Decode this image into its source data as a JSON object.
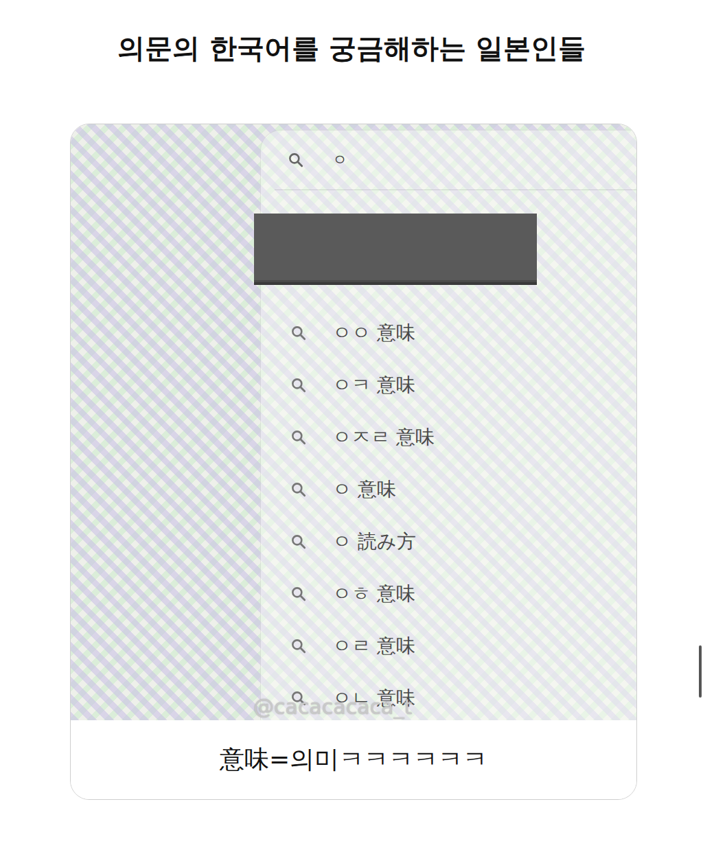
{
  "title": "의문의 한국어를 궁금해하는 일본인들",
  "search": {
    "query": "ㅇ"
  },
  "suggestions": [
    "ㅇㅇ 意味",
    "ㅇㅋ 意味",
    "ㅇㅈㄹ 意味",
    "ㅇ 意味",
    "ㅇ 読み方",
    "ㅇㅎ 意味",
    "ㅇㄹ 意味",
    "ㅇㄴ 意味"
  ],
  "watermark": "@cacacacaca_t",
  "caption": "意味=의미ㅋㅋㅋㅋㅋㅋ"
}
